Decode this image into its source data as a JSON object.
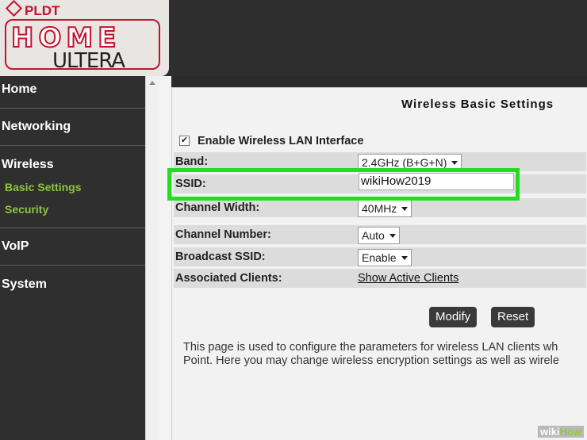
{
  "logo": {
    "brand": "PLDT",
    "home": "HOME",
    "ultera": "ULTERA"
  },
  "sidebar": {
    "items": [
      {
        "label": "Home"
      },
      {
        "label": "Networking"
      },
      {
        "label": "Wireless"
      },
      {
        "label": "VoIP"
      },
      {
        "label": "System"
      }
    ],
    "subitems": [
      {
        "label": "Basic Settings"
      },
      {
        "label": "Security"
      }
    ]
  },
  "main": {
    "title": "Wireless Basic Settings",
    "enable_wlan": {
      "label": "Enable Wireless LAN Interface",
      "checked": true,
      "check_glyph": "✔"
    },
    "band": {
      "label": "Band:",
      "value": "2.4GHz (B+G+N)"
    },
    "ssid": {
      "label": "SSID:",
      "value": "wikiHow2019"
    },
    "channel_width": {
      "label": "Channel Width:",
      "value": "40MHz"
    },
    "channel_number": {
      "label": "Channel Number:",
      "value": "Auto"
    },
    "broadcast_ssid": {
      "label": "Broadcast SSID:",
      "value": "Enable"
    },
    "associated_clients": {
      "label": "Associated Clients:",
      "link": "Show Active Clients"
    },
    "buttons": {
      "modify": "Modify",
      "reset": "Reset"
    },
    "description_line1": "This page is used to configure the parameters for wireless LAN clients wh",
    "description_line2": "Point. Here you may change wireless encryption settings as well as wirele"
  },
  "watermark": {
    "wiki": "wiki",
    "how": "How"
  },
  "colors": {
    "highlight": "#22dd22",
    "submenu": "#8cc63f",
    "brand": "#c8102e"
  }
}
